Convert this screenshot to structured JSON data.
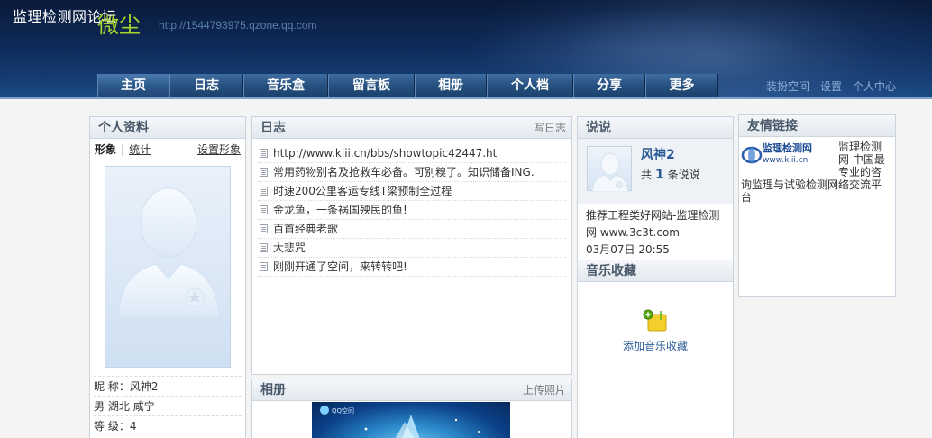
{
  "header": {
    "forum_title": "监理检测网论坛",
    "site_name": "微尘",
    "site_url": "http://1544793975.qzone.qq.com"
  },
  "nav": {
    "items": [
      "主页",
      "日志",
      "音乐盒",
      "留言板",
      "相册",
      "个人档",
      "分享",
      "更多"
    ]
  },
  "top_links": [
    "装扮空间",
    "设置",
    "个人中心"
  ],
  "profile": {
    "title": "个人资料",
    "tab_active": "形象",
    "tab_other": "统计",
    "set_link": "设置形象",
    "nickname": "昵  称：风神2",
    "location": "男  湖北  咸宁",
    "level": "等  级：4"
  },
  "diary": {
    "title": "日志",
    "write_link": "写日志",
    "items": [
      "http://www.kiii.cn/bbs/showtopic42447.ht",
      "常用药物别名及抢救车必备。可别糗了。知识储备ING.",
      "时速200公里客运专线T梁预制全过程",
      "金龙鱼，一条祸国殃民的鱼!",
      "百首经典老歌",
      "大悲咒",
      "刚刚开通了空间，来转转吧!"
    ]
  },
  "album": {
    "title": "相册",
    "upload_link": "上传照片",
    "pic_caption": "QQ空间"
  },
  "say": {
    "title": "说说",
    "name": "风神2",
    "count_prefix": "共",
    "count": "1",
    "count_suffix": "条说说",
    "text": "推荐工程类好网站-监理检测网 www.3c3t.com",
    "time": "03月07日  20:55"
  },
  "music": {
    "title": "音乐收藏",
    "add_link": "添加音乐收藏"
  },
  "friends": {
    "title": "友情链接",
    "logo_text": "监理检测网",
    "logo_url": "www.kiii.cn",
    "desc": "监理检测网 中国最专业的咨询监理与试验检测网络交流平台"
  },
  "colors": {
    "accent_green": "#a8d430",
    "link_blue": "#2a5b95",
    "nav_blue": "#25507f"
  }
}
